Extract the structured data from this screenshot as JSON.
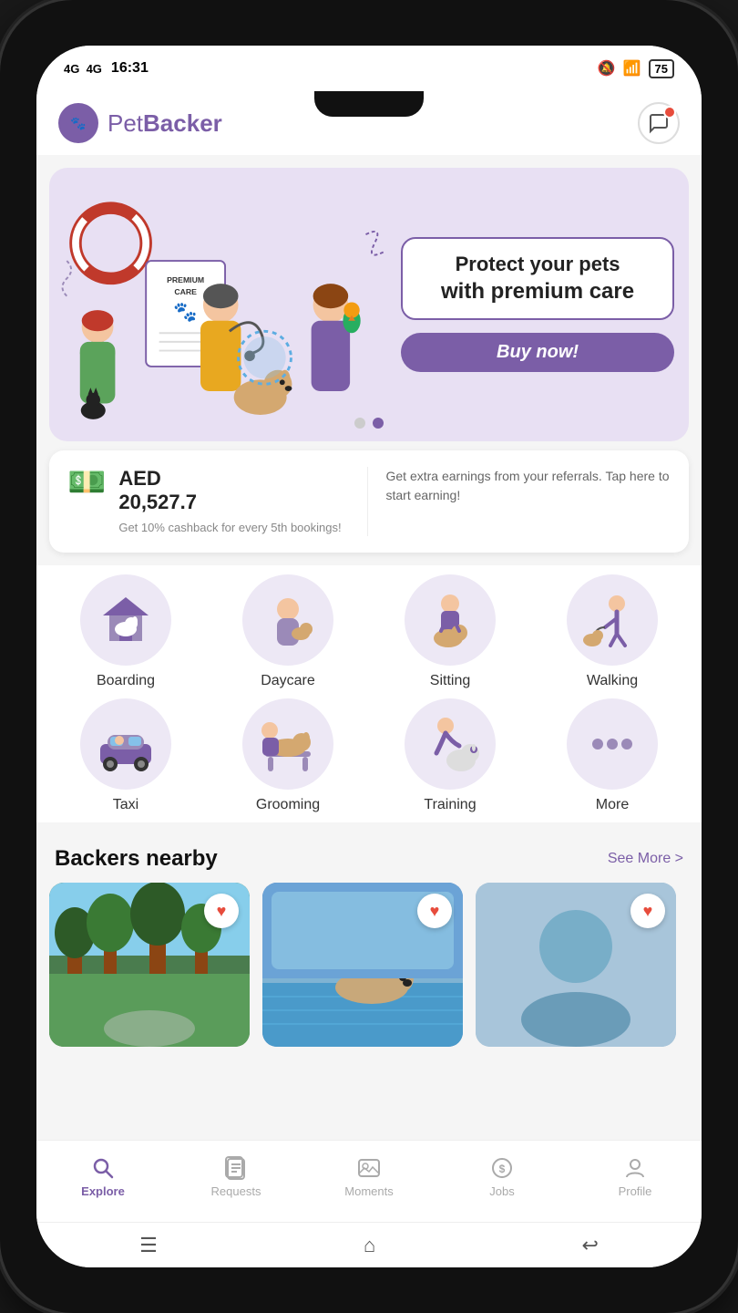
{
  "status": {
    "carrier": "4G  4G",
    "time": "16:31",
    "battery": "75",
    "wifi": true,
    "silent": true
  },
  "header": {
    "logo_text_regular": "Pet",
    "logo_text_bold": "Backer",
    "chat_label": "chat"
  },
  "banner": {
    "headline_line1": "Protect your pets",
    "headline_line2": "with premium care",
    "cta_label": "Buy now!",
    "dots": [
      false,
      true
    ],
    "premium_label": "PREMIUM\nCARE"
  },
  "earnings": {
    "currency": "AED",
    "amount": "20,527.7",
    "cashback_text": "Get 10% cashback for every 5th bookings!",
    "referral_text": "Get extra earnings from your referrals. Tap here to start earning!"
  },
  "services": [
    {
      "id": "boarding",
      "label": "Boarding",
      "emoji": "🏠",
      "color": "#7b5ea7"
    },
    {
      "id": "daycare",
      "label": "Daycare",
      "emoji": "🐕",
      "color": "#9b8ab8"
    },
    {
      "id": "sitting",
      "label": "Sitting",
      "emoji": "🐾",
      "color": "#8b7ab7"
    },
    {
      "id": "walking",
      "label": "Walking",
      "emoji": "🦮",
      "color": "#b0a0d0"
    },
    {
      "id": "taxi",
      "label": "Taxi",
      "emoji": "🚗",
      "color": "#7b5ea7"
    },
    {
      "id": "grooming",
      "label": "Grooming",
      "emoji": "✂️",
      "color": "#9b8ab8"
    },
    {
      "id": "training",
      "label": "Training",
      "emoji": "🎓",
      "color": "#8b7ab7"
    },
    {
      "id": "more",
      "label": "More",
      "emoji": "···",
      "color": "#b0a0d0"
    }
  ],
  "nearby": {
    "title": "Backers nearby",
    "see_more_label": "See More >"
  },
  "nav": [
    {
      "id": "explore",
      "label": "Explore",
      "icon": "🔍",
      "active": true
    },
    {
      "id": "requests",
      "label": "Requests",
      "icon": "📋",
      "active": false
    },
    {
      "id": "moments",
      "label": "Moments",
      "icon": "🖼️",
      "active": false
    },
    {
      "id": "jobs",
      "label": "Jobs",
      "icon": "💰",
      "active": false
    },
    {
      "id": "profile",
      "label": "Profile",
      "icon": "👤",
      "active": false
    }
  ],
  "colors": {
    "primary": "#7b5ea7",
    "primary_light": "#ede8f5",
    "danger": "#e74c3c",
    "text_dark": "#111",
    "text_muted": "#888"
  }
}
